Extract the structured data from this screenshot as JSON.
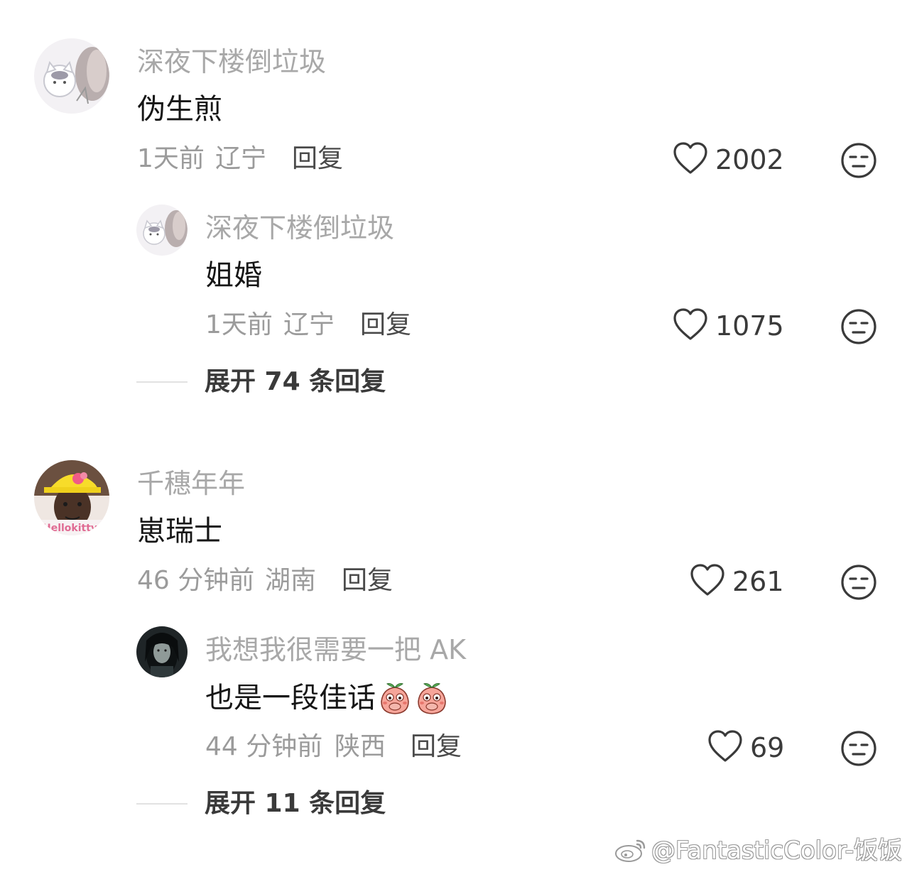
{
  "comments": [
    {
      "username": "深夜下楼倒垃圾",
      "text": "伪生煎",
      "time": "1天前",
      "location": "辽宁",
      "reply_label": "回复",
      "likes": "2002",
      "replies": [
        {
          "username": "深夜下楼倒垃圾",
          "text": "姐婚",
          "time": "1天前",
          "location": "辽宁",
          "reply_label": "回复",
          "likes": "1075"
        }
      ],
      "expand_label": "展开 74 条回复"
    },
    {
      "username": "千穗年年",
      "text": "崽瑞士",
      "time": "46 分钟前",
      "location": "湖南",
      "reply_label": "回复",
      "likes": "261",
      "avatar_text": "Hellokitty",
      "replies": [
        {
          "username": "我想我很需要一把 AK",
          "text": "也是一段佳话",
          "emoji": "peach-covering-mouth",
          "time": "44 分钟前",
          "location": "陕西",
          "reply_label": "回复",
          "likes": "69"
        }
      ],
      "expand_label": "展开 11 条回复"
    }
  ],
  "watermark": "@FantasticColor-饭饭",
  "icons": {
    "like": "heart-outline-icon",
    "dislike": "meh-face-icon",
    "watermark_logo": "weibo-logo-icon"
  },
  "colors": {
    "background": "#ffffff",
    "username": "#a8a8a8",
    "content": "#161616",
    "meta": "#9b9b9b"
  }
}
